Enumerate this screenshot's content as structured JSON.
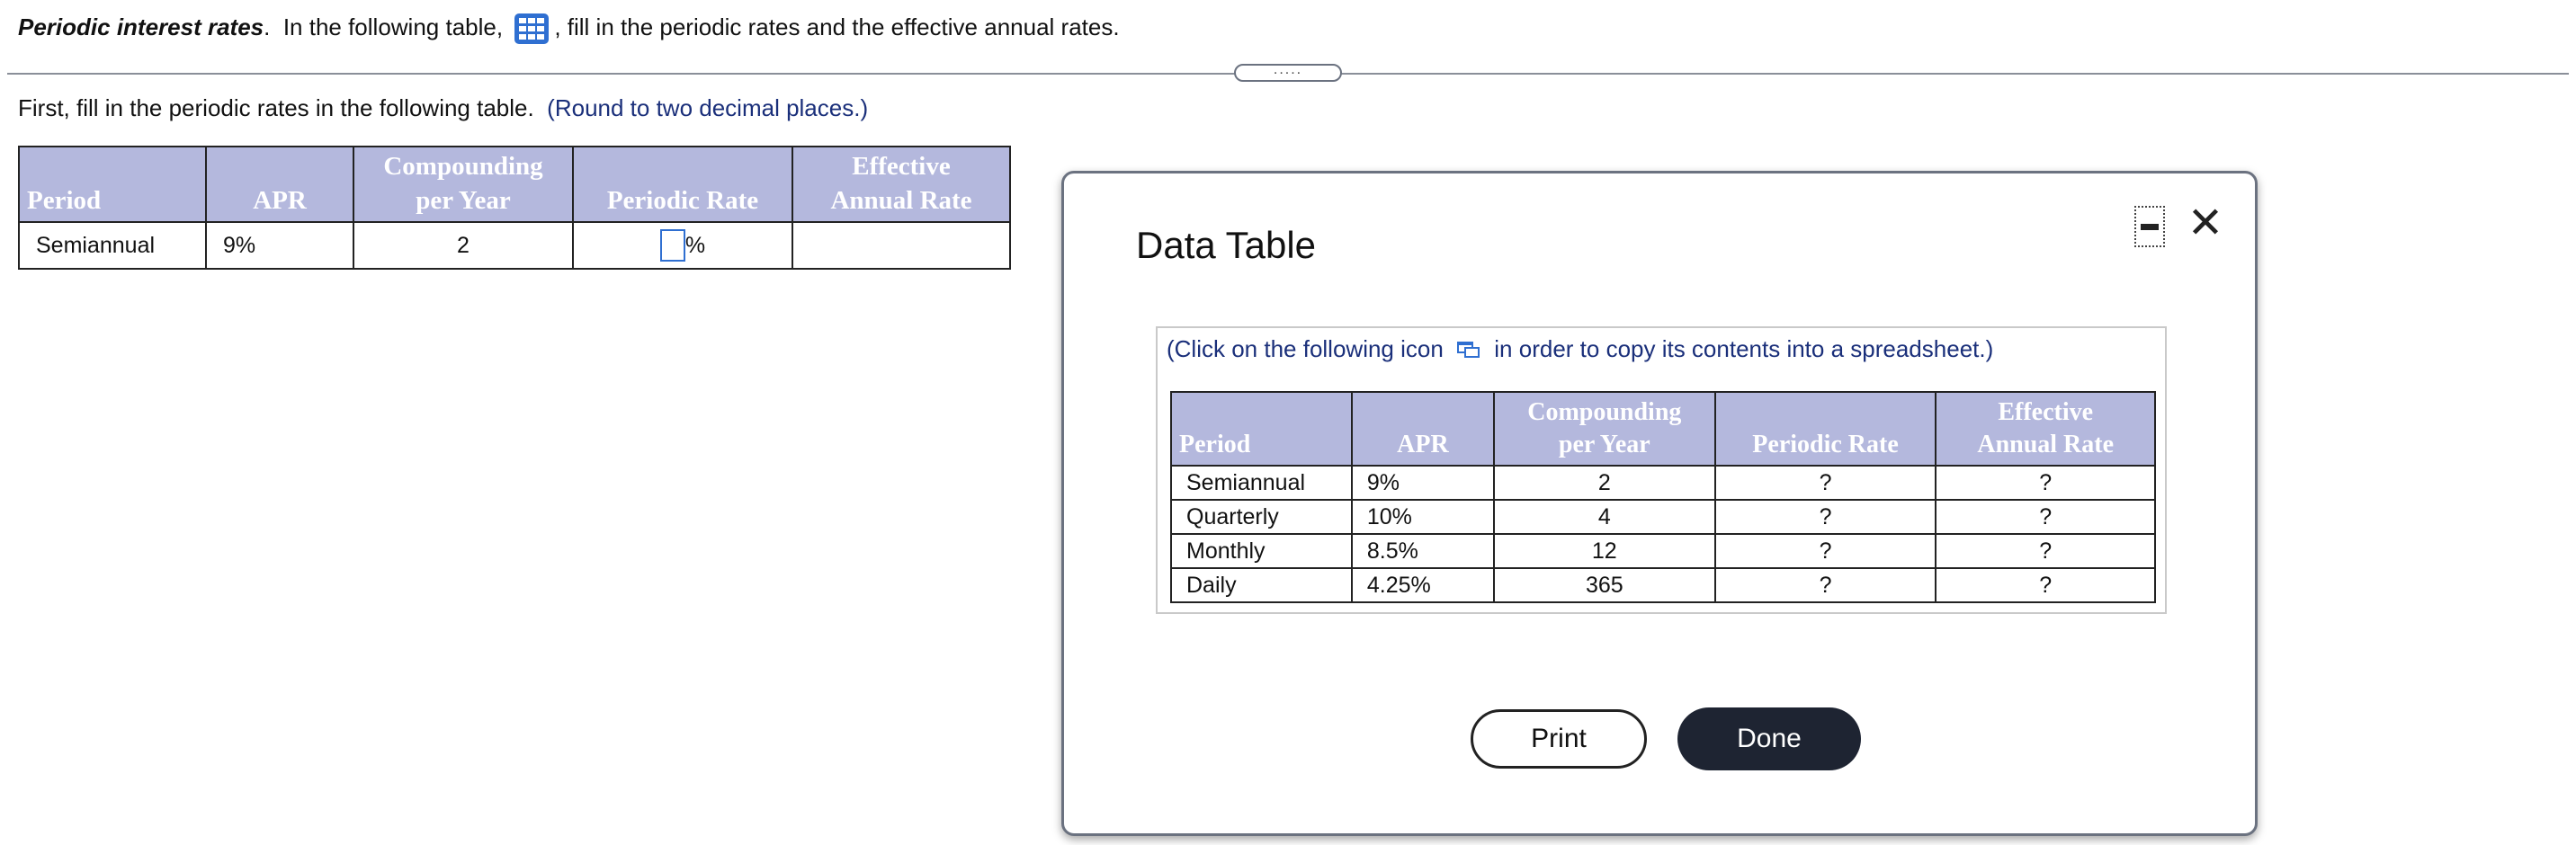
{
  "header": {
    "title": "Periodic interest rates",
    "title_suffix": ".",
    "text_before_icon": "In the following table,",
    "text_after_icon": ", fill in the periodic rates and the effective annual rates.",
    "icon": "table-grid-icon"
  },
  "divider": {
    "grip_label": "....."
  },
  "instruction": {
    "text": "First, fill in the periodic rates in the following table.",
    "hint": "(Round to two decimal places.)"
  },
  "question_table": {
    "headers": {
      "period": "Period",
      "apr": "APR",
      "compounding_line1": "Compounding",
      "compounding_line2": "per Year",
      "periodic_rate": "Periodic Rate",
      "ear_line1": "Effective",
      "ear_line2": "Annual Rate"
    },
    "row": {
      "period": "Semiannual",
      "apr": "9%",
      "compounding": "2",
      "periodic_rate_value": "",
      "periodic_rate_unit": "%",
      "ear": ""
    }
  },
  "data_modal": {
    "title": "Data Table",
    "note_before_icon": "(Click on the following icon",
    "note_after_icon": "in order to copy its contents into a spreadsheet.)",
    "headers": {
      "period": "Period",
      "apr": "APR",
      "compounding_line1": "Compounding",
      "compounding_line2": "per Year",
      "periodic_rate": "Periodic Rate",
      "ear_line1": "Effective",
      "ear_line2": "Annual Rate"
    },
    "rows": [
      {
        "period": "Semiannual",
        "apr": "9%",
        "compounding": "2",
        "periodic_rate": "?",
        "ear": "?"
      },
      {
        "period": "Quarterly",
        "apr": "10%",
        "compounding": "4",
        "periodic_rate": "?",
        "ear": "?"
      },
      {
        "period": "Monthly",
        "apr": "8.5%",
        "compounding": "12",
        "periodic_rate": "?",
        "ear": "?"
      },
      {
        "period": "Daily",
        "apr": "4.25%",
        "compounding": "365",
        "periodic_rate": "?",
        "ear": "?"
      }
    ],
    "buttons": {
      "print": "Print",
      "done": "Done"
    },
    "close_symbol": "✕"
  },
  "colors": {
    "table_header_bg": "#b4b8dd",
    "hint_text": "#1a2f7a",
    "accent_blue": "#2f6fd1",
    "done_button_bg": "#1e2432"
  }
}
